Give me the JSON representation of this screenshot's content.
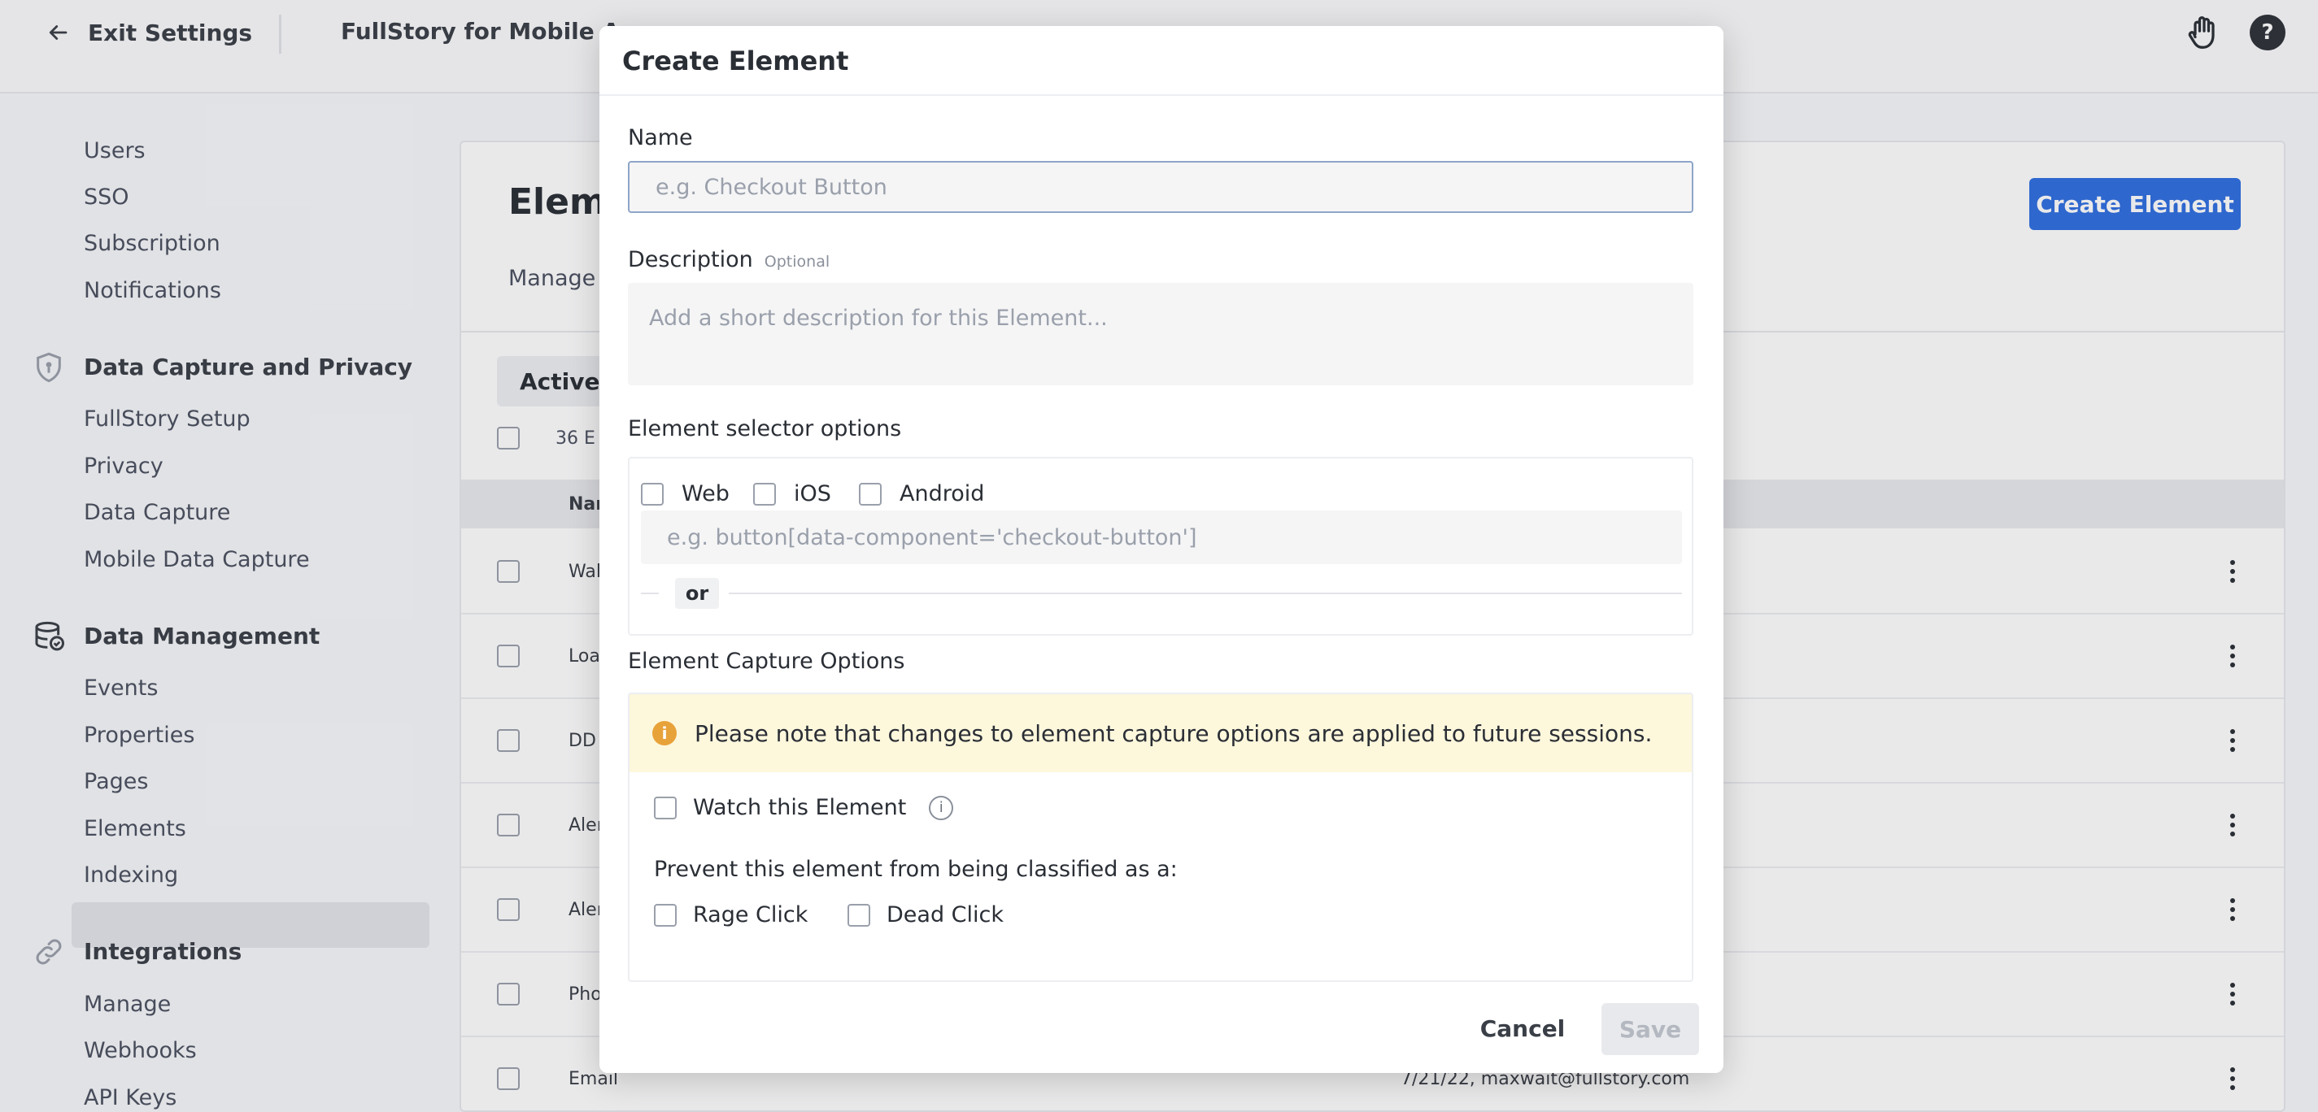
{
  "topbar": {
    "exit_label": "Exit Settings",
    "app_title": "FullStory for Mobile Apps",
    "help_glyph": "?"
  },
  "sidebar": {
    "account_items": [
      {
        "label": "Users"
      },
      {
        "label": "SSO"
      },
      {
        "label": "Subscription"
      },
      {
        "label": "Notifications"
      }
    ],
    "sections": [
      {
        "heading": "Data Capture and Privacy",
        "icon": "shield-icon",
        "items": [
          {
            "label": "FullStory Setup"
          },
          {
            "label": "Privacy"
          },
          {
            "label": "Data Capture"
          },
          {
            "label": "Mobile Data Capture"
          }
        ]
      },
      {
        "heading": "Data Management",
        "icon": "database-icon",
        "items": [
          {
            "label": "Events"
          },
          {
            "label": "Properties"
          },
          {
            "label": "Pages"
          },
          {
            "label": "Elements",
            "active": true
          },
          {
            "label": "Indexing"
          }
        ]
      },
      {
        "heading": "Integrations",
        "icon": "link-icon",
        "items": [
          {
            "label": "Manage"
          },
          {
            "label": "Webhooks"
          },
          {
            "label": "API Keys"
          }
        ]
      }
    ]
  },
  "main": {
    "title": "Eleme",
    "description": "Manage t",
    "create_button": "Create Element",
    "tab_active": "Active",
    "count_text": "36 E",
    "column_name": "Nar",
    "rows": [
      {
        "name": "Wal",
        "meta": ""
      },
      {
        "name": "Loa",
        "meta": ""
      },
      {
        "name": "DD -",
        "meta": ""
      },
      {
        "name": "Aler",
        "meta": ""
      },
      {
        "name": "Aler",
        "meta": ""
      },
      {
        "name": "Pho",
        "meta": ""
      },
      {
        "name": "Email",
        "meta": "7/21/22, maxwait@fullstory.com"
      }
    ]
  },
  "modal": {
    "title": "Create Element",
    "name_label": "Name",
    "name_placeholder": "e.g. Checkout Button",
    "name_value": "",
    "description_label": "Description",
    "description_optional": "Optional",
    "description_placeholder": "Add a short description for this Element...",
    "selector_label": "Element selector options",
    "platforms": [
      {
        "label": "Web",
        "checked": false
      },
      {
        "label": "iOS",
        "checked": false
      },
      {
        "label": "Android",
        "checked": false
      }
    ],
    "selector_placeholder": "e.g. button[data-component='checkout-button']",
    "or_label": "or",
    "capture_label": "Element Capture Options",
    "notice_text": "Please note that changes to element capture options are applied to future sessions.",
    "notice_glyph": "i",
    "watch_label": "Watch this Element",
    "info_glyph": "i",
    "prevent_label": "Prevent this element from being classified as a:",
    "rage_click_label": "Rage Click",
    "dead_click_label": "Dead Click",
    "cancel_label": "Cancel",
    "save_label": "Save"
  },
  "colors": {
    "primary": "#2f6fe0",
    "notice_bg": "#fdf7dc",
    "warning": "#e8a23a",
    "save_disabled_bg": "#e8e9ec"
  }
}
